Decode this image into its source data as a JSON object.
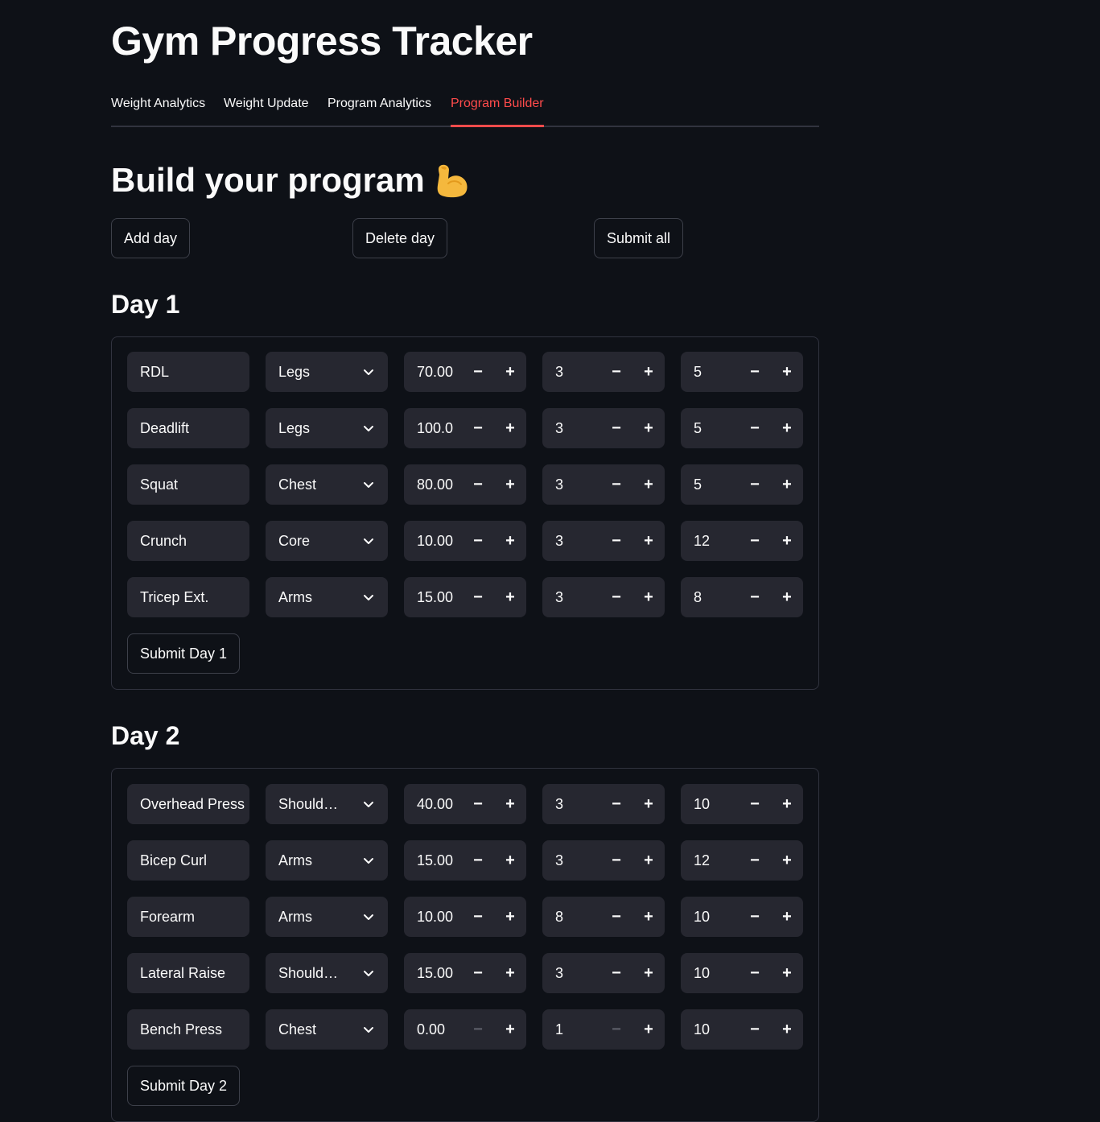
{
  "app_title": "Gym Progress Tracker",
  "tabs": [
    {
      "label": "Weight Analytics"
    },
    {
      "label": "Weight Update"
    },
    {
      "label": "Program Analytics"
    },
    {
      "label": "Program Builder",
      "active": true
    }
  ],
  "section_title": "Build your program",
  "section_icon": "flexed-biceps-icon",
  "buttons": {
    "add_day": "Add day",
    "delete_day": "Delete day",
    "submit_all": "Submit all"
  },
  "colors": {
    "background": "#0e1117",
    "input_bg": "#262730",
    "accent": "#ff4b4b",
    "text": "#fafafa"
  },
  "days": [
    {
      "title": "Day 1",
      "submit_label": "Submit Day 1",
      "exercises": [
        {
          "name": "RDL",
          "muscle": "Legs",
          "weight": "70.00",
          "sets": "3",
          "reps": "5"
        },
        {
          "name": "Deadlift",
          "muscle": "Legs",
          "weight": "100.0",
          "sets": "3",
          "reps": "5"
        },
        {
          "name": "Squat",
          "muscle": "Chest",
          "weight": "80.00",
          "sets": "3",
          "reps": "5"
        },
        {
          "name": "Crunch",
          "muscle": "Core",
          "weight": "10.00",
          "sets": "3",
          "reps": "12"
        },
        {
          "name": "Tricep Ext.",
          "muscle": "Arms",
          "weight": "15.00",
          "sets": "3",
          "reps": "8"
        }
      ]
    },
    {
      "title": "Day 2",
      "submit_label": "Submit Day 2",
      "exercises": [
        {
          "name": "Overhead Press",
          "muscle": "Should…",
          "weight": "40.00",
          "sets": "3",
          "reps": "10"
        },
        {
          "name": "Bicep Curl",
          "muscle": "Arms",
          "weight": "15.00",
          "sets": "3",
          "reps": "12"
        },
        {
          "name": "Forearm",
          "muscle": "Arms",
          "weight": "10.00",
          "sets": "8",
          "reps": "10"
        },
        {
          "name": "Lateral Raise",
          "muscle": "Should…",
          "weight": "15.00",
          "sets": "3",
          "reps": "10"
        },
        {
          "name": "Bench Press",
          "muscle": "Chest",
          "weight": "0.00",
          "sets": "1",
          "reps": "10",
          "weight_min": true,
          "sets_min": true
        }
      ]
    }
  ]
}
